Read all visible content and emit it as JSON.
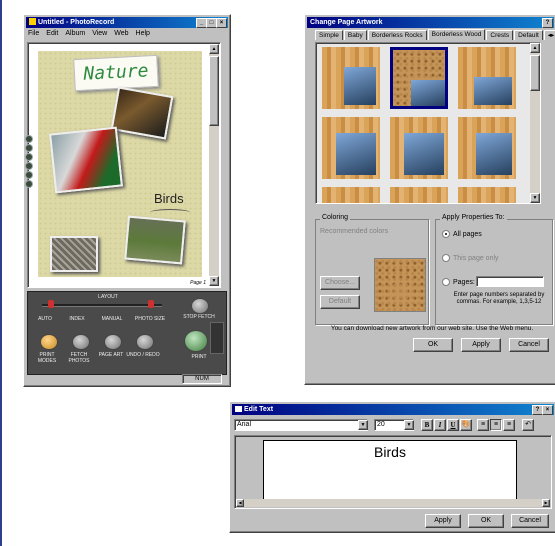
{
  "main_window": {
    "title": "Untitled - PhotoRecord",
    "menu": [
      "File",
      "Edit",
      "Album",
      "View",
      "Web",
      "Help"
    ],
    "page_title": "Nature",
    "caption": "Birds",
    "page_indicator": "Page 1",
    "status": "NUM",
    "layout_label": "LAYOUT",
    "modes": [
      "AUTO",
      "INDEX",
      "MANUAL",
      "PHOTO SIZE"
    ],
    "stop_fetch": "STOP FETCH",
    "print": "PRINT",
    "actions": [
      "PRINT MODES",
      "FETCH PHOTOS",
      "PAGE ART",
      "UNDO / REDO"
    ]
  },
  "artwork_dialog": {
    "title": "Change Page Artwork",
    "tabs": [
      "Simple",
      "Baby",
      "Borderless Rocks",
      "Borderless Wood",
      "Crests",
      "Default"
    ],
    "active_tab": "Borderless Wood",
    "coloring_label": "Coloring",
    "recommended_colors": "Recommended colors",
    "choose_button": "Choose...",
    "default_button": "Default",
    "apply_props_label": "Apply Properties To:",
    "options": [
      "All pages",
      "This page only",
      "Pages:"
    ],
    "selected_option": "All pages",
    "pages_hint": "Enter page numbers separated by commas. For example, 1,3,5-12",
    "download_note": "You can download new artwork from our web site. Use the Web menu.",
    "ok": "OK",
    "apply": "Apply",
    "cancel": "Cancel"
  },
  "edit_text_dialog": {
    "title": "Edit Text",
    "font": "Arial",
    "size": "20",
    "text_value": "Birds",
    "bold": "B",
    "italic": "I",
    "underline": "U",
    "apply": "Apply",
    "ok": "OK",
    "cancel": "Cancel"
  }
}
